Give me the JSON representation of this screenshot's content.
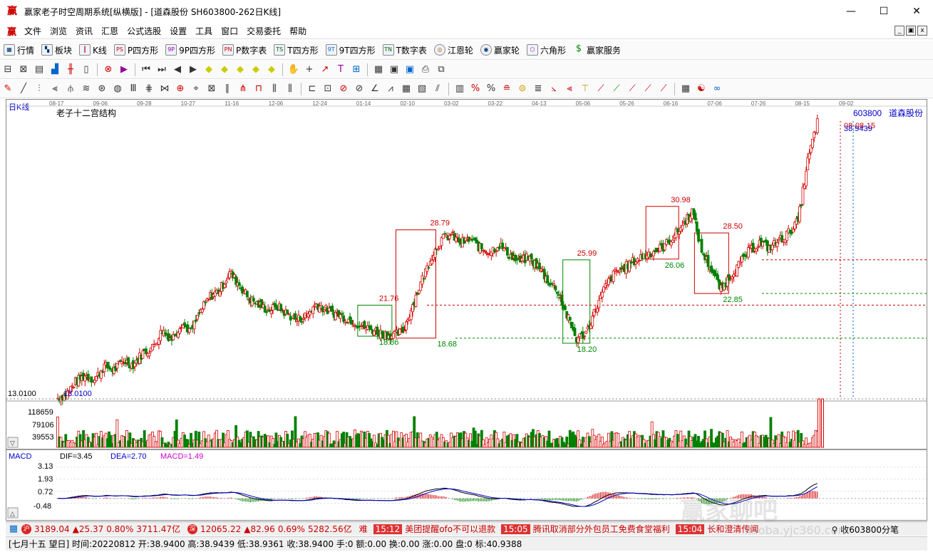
{
  "window": {
    "title": "赢家老子时空周期系统[纵横版] - [道森股份  SH603800-262日K线]",
    "app_icon": "赢",
    "buttons": [
      "minimize",
      "maximize",
      "close"
    ]
  },
  "menu": {
    "logo": "赢",
    "items": [
      "文件",
      "浏览",
      "资讯",
      "汇恩",
      "公式选股",
      "设置",
      "工具",
      "窗口",
      "交易委托",
      "帮助"
    ]
  },
  "toolbar1": {
    "items": [
      {
        "icon": "grid-icon",
        "label": "行情"
      },
      {
        "icon": "blocks-icon",
        "label": "板块"
      },
      {
        "icon": "kline-icon",
        "label": "K线"
      },
      {
        "icon": "ps-icon",
        "label": "P四方形"
      },
      {
        "icon": "9p-icon",
        "label": "9P四方形"
      },
      {
        "icon": "pn-icon",
        "label": "P数字表"
      },
      {
        "icon": "ts-icon",
        "label": "T四方形"
      },
      {
        "icon": "9t-icon",
        "label": "9T四方形"
      },
      {
        "icon": "tn-icon",
        "label": "T数字表"
      },
      {
        "icon": "wheel-icon",
        "label": "江恩轮"
      },
      {
        "icon": "wheel2-icon",
        "label": "赢家轮"
      },
      {
        "icon": "hexagon-icon",
        "label": "六角形"
      },
      {
        "icon": "dollar-icon",
        "label": "赢家服务"
      }
    ]
  },
  "chart": {
    "period_label": "日K线",
    "indicator_title": "老子十二宫结构",
    "stock_code": "603800",
    "stock_name": "道森股份",
    "date_ticks": [
      "08-17",
      "09-06",
      "09-28",
      "10-27",
      "11-16",
      "12-06",
      "12-24",
      "01-14",
      "02-10",
      "03-02",
      "03-22",
      "04-13",
      "05-06",
      "05-26",
      "06-16",
      "07-06",
      "07-26",
      "08-15",
      "09-02"
    ],
    "max_date_label": "08-08-15",
    "max_price_label": "38.9439",
    "min_price_label": "13.0100",
    "min_axis_label": "13.0100",
    "price_annotations": [
      "28.79",
      "21.76",
      "18.86",
      "18.68",
      "25.99",
      "18.20",
      "30.98",
      "26.06",
      "28.50",
      "22.85"
    ],
    "volume_axis": [
      "118659",
      "79106",
      "39553"
    ],
    "macd": {
      "label": "MACD",
      "dif": "DIF=3.45",
      "dea": "DEA=2.70",
      "macd": "MACD=1.49",
      "axis": [
        "3.13",
        "1.93",
        "0.72",
        "-0.48"
      ]
    }
  },
  "chart_data": {
    "type": "candlestick",
    "title": "老子十二宫结构",
    "x_range": [
      "08-17",
      "09-02"
    ],
    "ylim": [
      13.01,
      38.9439
    ],
    "boxes": [
      {
        "from": "01-14",
        "low": 18.86,
        "high": 21.76
      },
      {
        "from": "02-10",
        "low": 18.68,
        "high": 28.79
      },
      {
        "from": "05-06",
        "low": 18.2,
        "high": 25.99
      },
      {
        "from": "05-26",
        "low": 26.06,
        "high": 30.98
      },
      {
        "from": "07-06",
        "low": 22.85,
        "high": 28.5
      }
    ],
    "close_series": [
      13.0,
      13.4,
      14.6,
      15.2,
      14.8,
      16.1,
      15.7,
      16.6,
      16.2,
      17.3,
      17.8,
      19.4,
      18.6,
      20.1,
      19.3,
      21.2,
      22.6,
      23.2,
      24.8,
      23.7,
      22.4,
      21.8,
      21.3,
      21.6,
      20.9,
      20.4,
      20.8,
      21.9,
      21.3,
      21.0,
      20.6,
      20.2,
      19.7,
      19.4,
      19.1,
      18.9,
      19.3,
      21.8,
      24.2,
      26.4,
      27.9,
      28.3,
      27.6,
      27.9,
      27.1,
      26.8,
      27.4,
      26.5,
      25.8,
      26.2,
      25.4,
      24.1,
      23.2,
      20.8,
      18.6,
      19.2,
      21.4,
      23.5,
      24.8,
      25.3,
      25.9,
      26.4,
      26.8,
      27.2,
      28.1,
      29.2,
      30.6,
      26.8,
      25.1,
      23.2,
      24.6,
      25.7,
      26.9,
      27.6,
      27.1,
      27.8,
      28.5,
      29.6,
      35.2,
      38.9
    ]
  },
  "status": {
    "index1": {
      "value": "3189.04",
      "change": "▲25.37",
      "pct": "0.80%",
      "amount": "3711.47亿"
    },
    "index2": {
      "value": "12065.22",
      "change": "▲82.96",
      "pct": "0.69%",
      "amount": "5282.56亿"
    },
    "news": [
      {
        "time": "15:12",
        "text": "美团提醒ofo不可以退款"
      },
      {
        "time": "15:05",
        "text": "腾讯取消部分外包员工免费食堂福利"
      },
      {
        "time": "15:04",
        "text": "长和澄清传闻"
      }
    ],
    "right": "收603800分笔",
    "news_prefix": "难"
  },
  "infobar": {
    "text": "[七月十五  望日] 时间:20220812 开:38.9400 高:38.9439 低:38.9361 收:38.9400 手:0 额:0.00 换:0.00 涨:0.00 盘:0 标:40.9388"
  },
  "watermark": {
    "text": "赢家聊吧",
    "url": "liaoba.yjc360.com"
  },
  "colors": {
    "up": "#d40000",
    "down": "#008000",
    "dif": "#000000",
    "dea": "#0000cc",
    "macd_label": "#cc00cc"
  }
}
